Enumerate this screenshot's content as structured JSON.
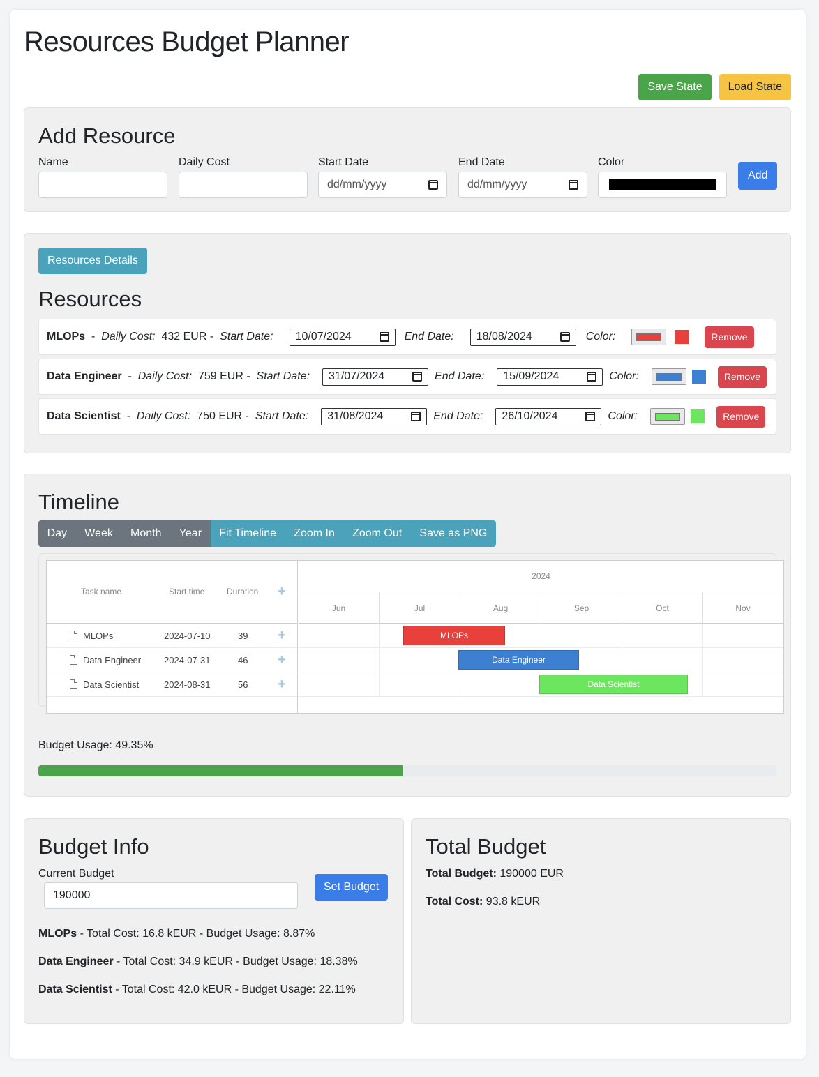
{
  "app": {
    "title": "Resources Budget Planner",
    "save_state": "Save State",
    "load_state": "Load State"
  },
  "add_resource": {
    "title": "Add Resource",
    "name_label": "Name",
    "daily_cost_label": "Daily Cost",
    "start_date_label": "Start Date",
    "start_date_placeholder": "dd/mm/yyyy",
    "end_date_label": "End Date",
    "end_date_placeholder": "dd/mm/yyyy",
    "color_label": "Color",
    "color_value": "#000000",
    "add_button": "Add"
  },
  "resources": {
    "details_button": "Resources Details",
    "title": "Resources",
    "daily_cost_label": "Daily Cost:",
    "start_date_label": "Start Date:",
    "end_date_label": "End Date:",
    "color_label": "Color:",
    "remove_label": "Remove",
    "items": [
      {
        "name": "MLOPs",
        "cost": "432 EUR",
        "start": "10/07/2024",
        "end": "18/08/2024",
        "color": "#e8403a"
      },
      {
        "name": "Data Engineer",
        "cost": "759 EUR",
        "start": "31/07/2024",
        "end": "15/09/2024",
        "color": "#3d7fd1"
      },
      {
        "name": "Data Scientist",
        "cost": "750 EUR",
        "start": "31/08/2024",
        "end": "26/10/2024",
        "color": "#6ce65e"
      }
    ]
  },
  "timeline": {
    "title": "Timeline",
    "view_buttons": [
      "Day",
      "Week",
      "Month",
      "Year"
    ],
    "action_buttons": [
      "Fit Timeline",
      "Zoom In",
      "Zoom Out",
      "Save as PNG"
    ],
    "columns": {
      "task": "Task name",
      "start": "Start time",
      "duration": "Duration"
    },
    "year": "2024",
    "months": [
      "Jun",
      "Jul",
      "Aug",
      "Sep",
      "Oct",
      "Nov"
    ],
    "tasks": [
      {
        "name": "MLOPs",
        "start": "2024-07-10",
        "duration": "39",
        "color": "#e8403a"
      },
      {
        "name": "Data Engineer",
        "start": "2024-07-31",
        "duration": "46",
        "color": "#3d7fd1"
      },
      {
        "name": "Data Scientist",
        "start": "2024-08-31",
        "duration": "56",
        "color": "#6ce65e"
      }
    ],
    "budget_usage_label": "Budget Usage: 49.35%",
    "budget_usage_value": 49.35
  },
  "budget_info": {
    "title": "Budget Info",
    "current_budget_label": "Current Budget",
    "current_budget_value": "190000",
    "set_budget_button": "Set Budget",
    "lines": [
      {
        "name": "MLOPs",
        "text": " - Total Cost: 16.8 kEUR - Budget Usage: 8.87%"
      },
      {
        "name": "Data Engineer",
        "text": " - Total Cost: 34.9 kEUR - Budget Usage: 18.38%"
      },
      {
        "name": "Data Scientist",
        "text": " - Total Cost: 42.0 kEUR - Budget Usage: 22.11%"
      }
    ]
  },
  "total_budget": {
    "title": "Total Budget",
    "total_budget_label": "Total Budget:",
    "total_budget_value": " 190000 EUR",
    "total_cost_label": "Total Cost:",
    "total_cost_value": " 93.8 kEUR"
  }
}
